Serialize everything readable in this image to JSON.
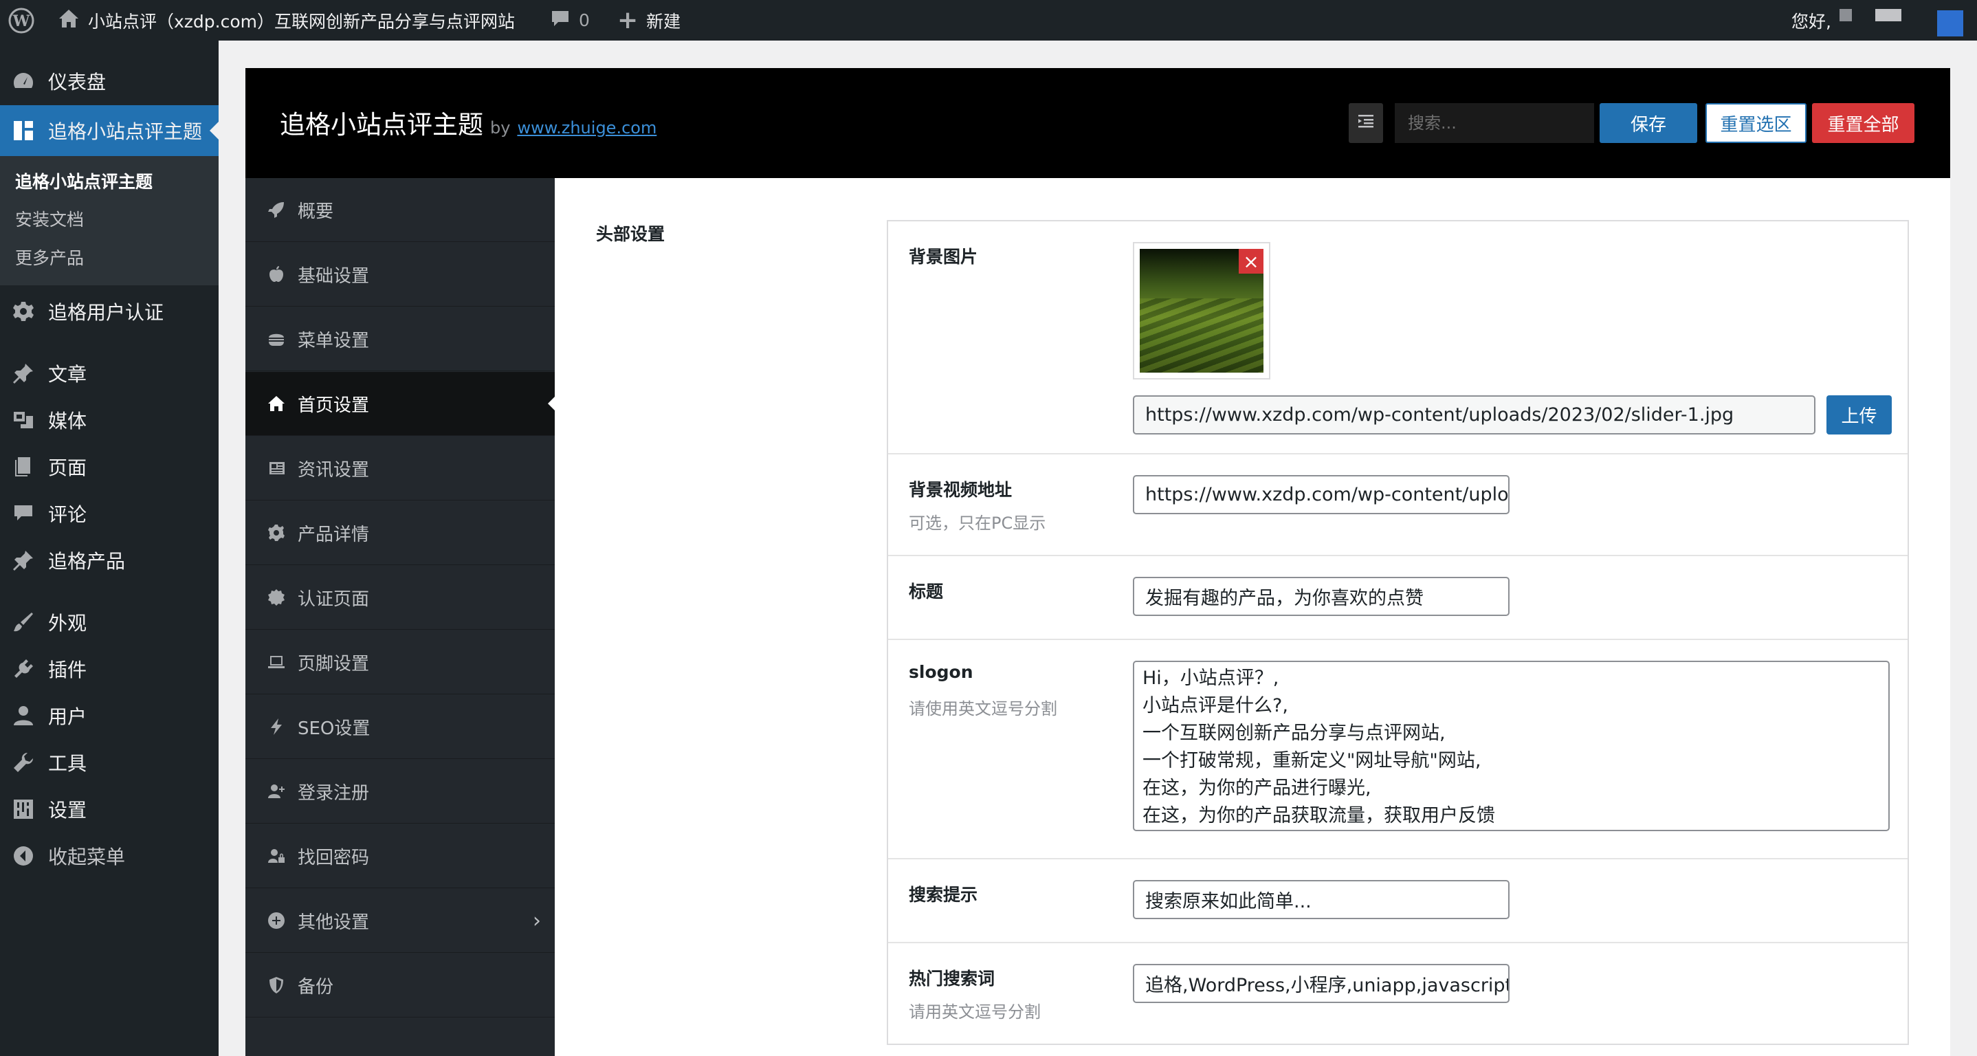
{
  "adminbar": {
    "site_title": "小站点评（xzdp.com）互联网创新产品分享与点评网站",
    "comments_count": "0",
    "new_label": "新建",
    "greeting": "您好,"
  },
  "adminmenu": {
    "dashboard": "仪表盘",
    "theme": "追格小站点评主题",
    "submenu": [
      "追格小站点评主题",
      "安装文档",
      "更多产品"
    ],
    "user_auth": "追格用户认证",
    "posts": "文章",
    "media": "媒体",
    "pages": "页面",
    "comments": "评论",
    "products": "追格产品",
    "appearance": "外观",
    "plugins": "插件",
    "users": "用户",
    "tools": "工具",
    "settings": "设置",
    "collapse": "收起菜单"
  },
  "panel": {
    "title": "追格小站点评主题",
    "by": "by",
    "author_link": "www.zhuige.com",
    "search_placeholder": "搜索...",
    "save": "保存",
    "reset_section": "重置选区",
    "reset_all": "重置全部"
  },
  "nav": [
    {
      "label": "概要",
      "icon": "rocket-icon"
    },
    {
      "label": "基础设置",
      "icon": "apple-icon"
    },
    {
      "label": "菜单设置",
      "icon": "burger-icon"
    },
    {
      "label": "首页设置",
      "icon": "home-icon"
    },
    {
      "label": "资讯设置",
      "icon": "newspaper-icon"
    },
    {
      "label": "产品详情",
      "icon": "gear-icon"
    },
    {
      "label": "认证页面",
      "icon": "badge-icon"
    },
    {
      "label": "页脚设置",
      "icon": "laptop-icon"
    },
    {
      "label": "SEO设置",
      "icon": "bolt-icon"
    },
    {
      "label": "登录注册",
      "icon": "user-plus-icon"
    },
    {
      "label": "找回密码",
      "icon": "user-lock-icon"
    },
    {
      "label": "其他设置",
      "icon": "plus-circle-icon"
    },
    {
      "label": "备份",
      "icon": "shield-icon"
    }
  ],
  "content": {
    "section_title": "头部设置",
    "fields": {
      "bg_image": {
        "label": "背景图片",
        "url": "https://www.xzdp.com/wp-content/uploads/2023/02/slider-1.jpg",
        "remove": "×",
        "upload": "上传"
      },
      "bg_video": {
        "label": "背景视频地址",
        "desc": "可选，只在PC显示",
        "value": "https://www.xzdp.com/wp-content/uploa"
      },
      "title": {
        "label": "标题",
        "value": "发掘有趣的产品，为你喜欢的点赞"
      },
      "slogon": {
        "label": "slogon",
        "desc": "请使用英文逗号分割",
        "lines": [
          "Hi，小站点评？,",
          "小站点评是什么?,",
          "一个互联网创新产品分享与点评网站,",
          "一个打破常规，重新定义\"网址导航\"网站,",
          "在这，为你的产品进行曝光,",
          "在这，为你的产品获取流量，获取用户反馈"
        ]
      },
      "search_hint": {
        "label": "搜索提示",
        "value": "搜索原来如此简单..."
      },
      "hot_words": {
        "label": "热门搜索词",
        "desc": "请用英文逗号分割",
        "value": "追格,WordPress,小程序,uniapp,javascript"
      }
    }
  }
}
